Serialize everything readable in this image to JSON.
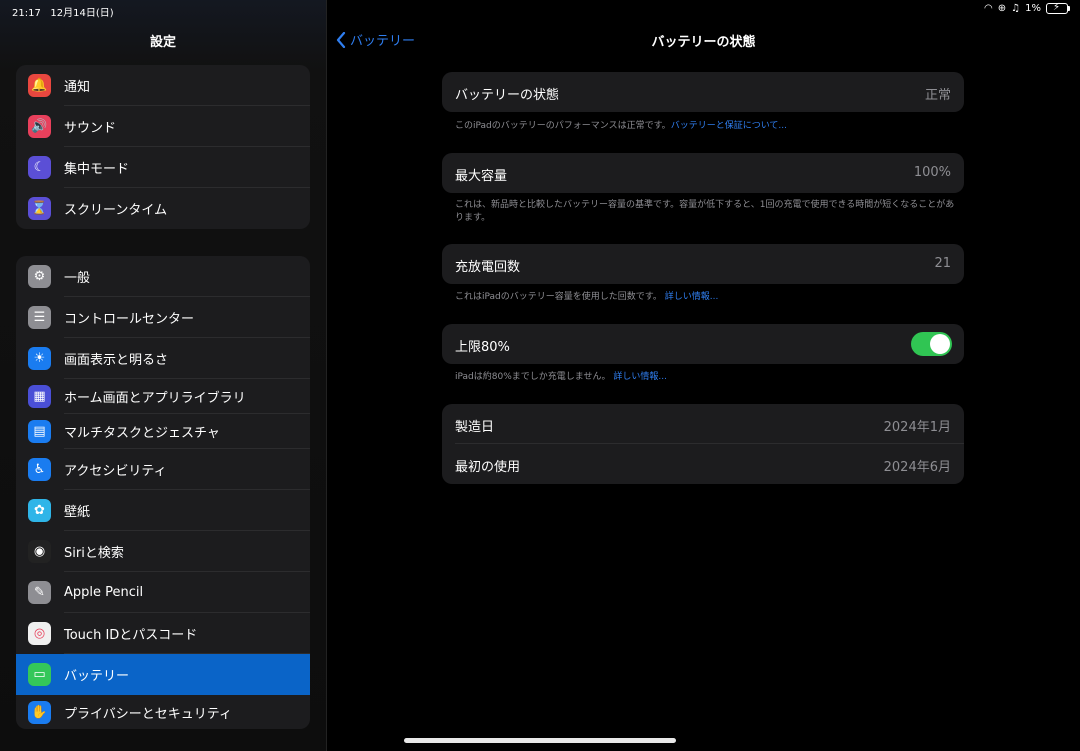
{
  "status_bar": {
    "time": "21:17",
    "date": "12月14日(日)",
    "battery_percent": "1%"
  },
  "sidebar": {
    "title": "設定",
    "group1": [
      {
        "label": "通知",
        "icon": "bell-icon",
        "color": "#e8473f",
        "glyph": "🔔"
      },
      {
        "label": "サウンド",
        "icon": "speaker-icon",
        "color": "#e8405c",
        "glyph": "🔊"
      },
      {
        "label": "集中モード",
        "icon": "moon-icon",
        "color": "#5b4fd6",
        "glyph": "☾"
      },
      {
        "label": "スクリーンタイム",
        "icon": "hourglass-icon",
        "color": "#5b4fd6",
        "glyph": "⌛"
      }
    ],
    "group2": [
      {
        "label": "一般",
        "icon": "gear-icon",
        "color": "#8e8e93",
        "glyph": "⚙"
      },
      {
        "label": "コントロールセンター",
        "icon": "toggles-icon",
        "color": "#8e8e93",
        "glyph": "☰"
      },
      {
        "label": "画面表示と明るさ",
        "icon": "sun-icon",
        "color": "#1a7cf0",
        "glyph": "☀"
      },
      {
        "label": "ホーム画面とアプリライブラリ",
        "icon": "grid-icon",
        "color": "#4a4fd6",
        "glyph": "▦"
      },
      {
        "label": "マルチタスクとジェスチャ",
        "icon": "multitask-icon",
        "color": "#1a7cf0",
        "glyph": "▤"
      },
      {
        "label": "アクセシビリティ",
        "icon": "accessibility-icon",
        "color": "#1a7cf0",
        "glyph": "♿"
      },
      {
        "label": "壁紙",
        "icon": "flower-icon",
        "color": "#2fb5e8",
        "glyph": "✿"
      },
      {
        "label": "Siriと検索",
        "icon": "siri-icon",
        "color": "#222",
        "glyph": "◉"
      },
      {
        "label": "Apple Pencil",
        "icon": "pencil-icon",
        "color": "#8e8e93",
        "glyph": "✎"
      },
      {
        "label": "Touch IDとパスコード",
        "icon": "fingerprint-icon",
        "color": "#f0f0f0",
        "glyph": "◎"
      },
      {
        "label": "バッテリー",
        "icon": "battery-icon",
        "color": "#34c759",
        "glyph": "▭"
      },
      {
        "label": "プライバシーとセキュリティ",
        "icon": "hand-icon",
        "color": "#1a7cf0",
        "glyph": "✋"
      }
    ]
  },
  "nav": {
    "back_label": "バッテリー",
    "title": "バッテリーの状態"
  },
  "cards": {
    "health": {
      "key": "バッテリーの状態",
      "value": "正常",
      "footer": "このiPadのバッテリーのパフォーマンスは正常です。",
      "link": "バッテリーと保証について..."
    },
    "capacity": {
      "key": "最大容量",
      "value": "100%",
      "footer": "これは、新品時と比較したバッテリー容量の基準です。容量が低下すると、1回の充電で使用できる時間が短くなることがあります。"
    },
    "cycles": {
      "key": "充放電回数",
      "value": "21",
      "footer": "これはiPadのバッテリー容量を使用した回数です。",
      "link": "詳しい情報..."
    },
    "limit": {
      "key": "上限80%",
      "toggle_on": true,
      "footer": "iPadは約80%までしか充電しません。",
      "link": "詳しい情報..."
    },
    "dates": {
      "manufactured_key": "製造日",
      "manufactured_value": "2024年1月",
      "first_use_key": "最初の使用",
      "first_use_value": "2024年6月"
    }
  }
}
